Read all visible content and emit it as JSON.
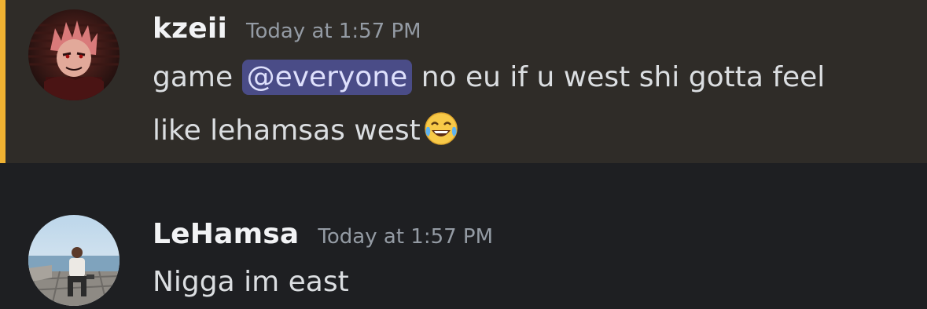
{
  "messages": [
    {
      "username": "kzeii",
      "timestamp": "Today at 1:57 PM",
      "text_before": "game ",
      "mention": "@everyone",
      "text_line1_after": "  no eu if u west shi gotta feel",
      "text_line2": "like lehamsas west",
      "emoji": "face-with-tears-of-joy",
      "highlighted": true,
      "highlight_color": "#f0b232"
    },
    {
      "username": "LeHamsa",
      "timestamp": "Today at 1:57 PM",
      "text": "Nigga im east",
      "highlighted": false
    }
  ],
  "colors": {
    "background": "#1e1f22",
    "highlight_background": "#2f2c28",
    "mention_background": "#4a4c87",
    "mention_text": "#dee0fc",
    "username": "#f2f3f5",
    "timestamp": "#949ba4",
    "message_text": "#dbdee1"
  }
}
